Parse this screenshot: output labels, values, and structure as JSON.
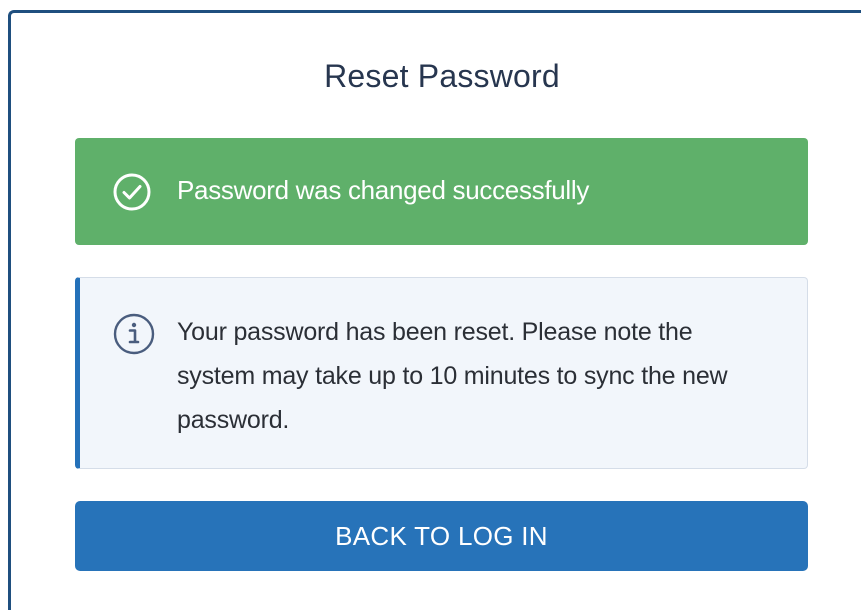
{
  "page": {
    "title": "Reset Password"
  },
  "success_alert": {
    "icon": "check-circle-icon",
    "message": "Password was changed successfully",
    "color": "#5fb06a"
  },
  "info_alert": {
    "icon": "info-circle-icon",
    "message": "Your password has been reset. Please note the system may take up to 10 minutes to sync the new password.",
    "accent_color": "#2471b9",
    "background_color": "#f2f6fb"
  },
  "actions": {
    "back_label": "BACK TO LOG IN",
    "button_color": "#2773b9"
  }
}
